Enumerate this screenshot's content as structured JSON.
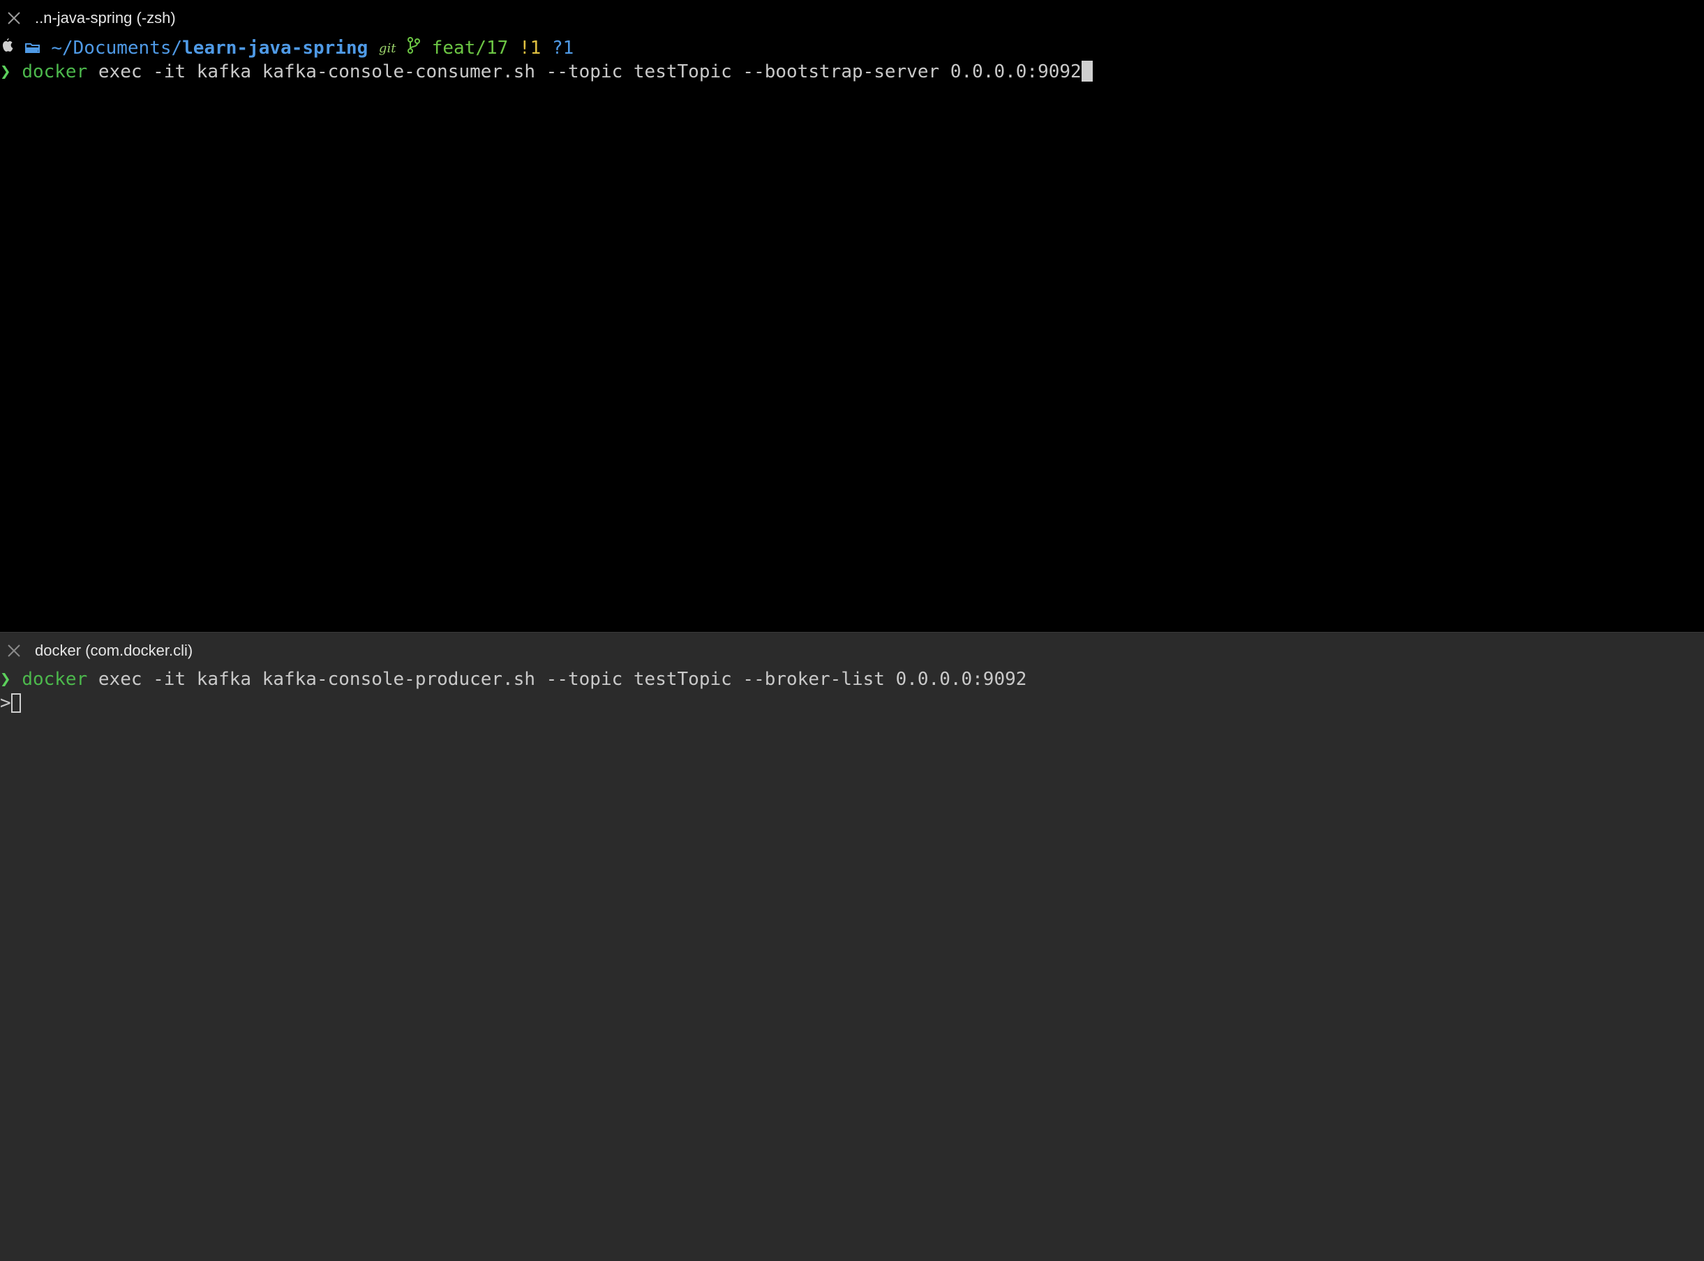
{
  "top_pane": {
    "title": "..n-java-spring (-zsh)",
    "prompt": {
      "path_prefix": "~/Documents/",
      "path_dir": "learn-java-spring",
      "git_label": "git",
      "branch": "feat/17",
      "status_modified": "!1",
      "status_untracked": "?1"
    },
    "command_line": {
      "chevron": "❯",
      "program": "docker",
      "args": " exec -it kafka kafka-console-consumer.sh --topic testTopic --bootstrap-server 0.0.0.0:9092"
    }
  },
  "bottom_pane": {
    "title": "docker (com.docker.cli)",
    "command_line": {
      "chevron": "❯",
      "program": "docker",
      "args": " exec -it kafka kafka-console-producer.sh --topic testTopic --broker-list 0.0.0.0:9092"
    },
    "input_prompt": ">"
  },
  "colors": {
    "top_background": "#000000",
    "bottom_background": "#2b2b2b",
    "command_green": "#4cb84c",
    "path_blue": "#4f9ae6",
    "status_yellow": "#e0c040"
  },
  "icons": [
    "close-icon",
    "apple-icon",
    "folder-icon",
    "git-branch-icon"
  ]
}
